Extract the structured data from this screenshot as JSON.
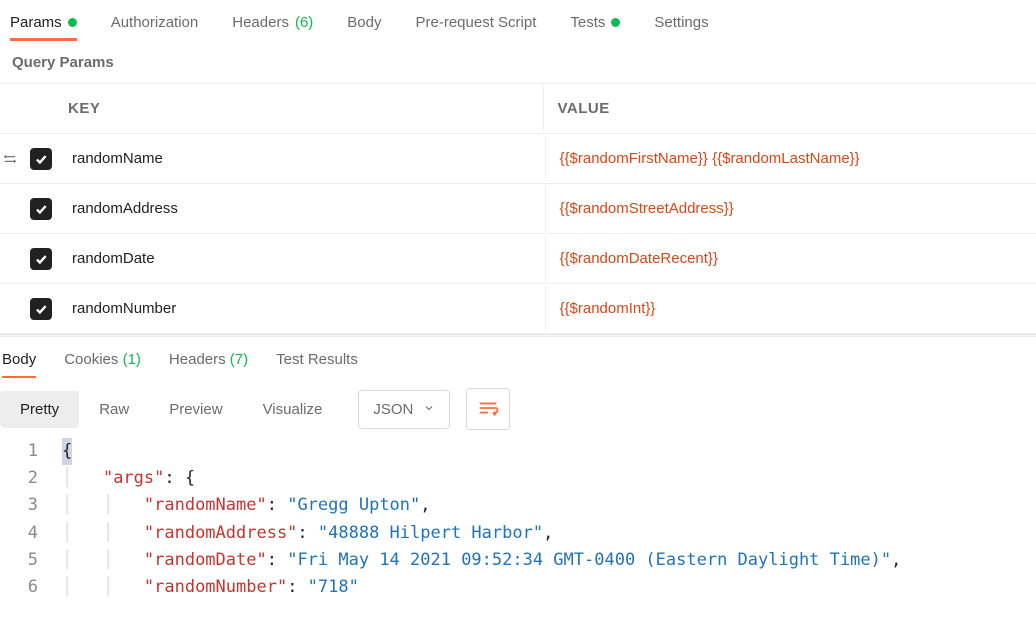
{
  "tabs": {
    "params": "Params",
    "authorization": "Authorization",
    "headers_label": "Headers",
    "headers_count": "(6)",
    "body": "Body",
    "prerequest": "Pre-request Script",
    "tests": "Tests",
    "settings": "Settings"
  },
  "section_title": "Query Params",
  "columns": {
    "key": "KEY",
    "value": "VALUE"
  },
  "rows": [
    {
      "key": "randomName",
      "value": "{{$randomFirstName}} {{$randomLastName}}"
    },
    {
      "key": "randomAddress",
      "value": "{{$randomStreetAddress}}"
    },
    {
      "key": "randomDate",
      "value": "{{$randomDateRecent}}"
    },
    {
      "key": "randomNumber",
      "value": "{{$randomInt}}"
    }
  ],
  "response_tabs": {
    "body": "Body",
    "cookies_label": "Cookies",
    "cookies_count": "(1)",
    "headers_label": "Headers",
    "headers_count": "(7)",
    "test_results": "Test Results"
  },
  "view_modes": {
    "pretty": "Pretty",
    "raw": "Raw",
    "preview": "Preview",
    "visualize": "Visualize"
  },
  "format_dd": "JSON",
  "code": {
    "open_brace": "{",
    "args_key": "\"args\"",
    "colon_brace": ": {",
    "rn_key": "\"randomName\"",
    "rn_val": "\"Gregg Upton\"",
    "ra_key": "\"randomAddress\"",
    "ra_val": "\"48888 Hilpert Harbor\"",
    "rd_key": "\"randomDate\"",
    "rd_val": "\"Fri May 14 2021 09:52:34 GMT-0400 (Eastern Daylight Time)\"",
    "rnum_key": "\"randomNumber\"",
    "rnum_val": "\"718\"",
    "comma": ",",
    "colon": ": "
  },
  "line_numbers": [
    "1",
    "2",
    "3",
    "4",
    "5",
    "6"
  ]
}
